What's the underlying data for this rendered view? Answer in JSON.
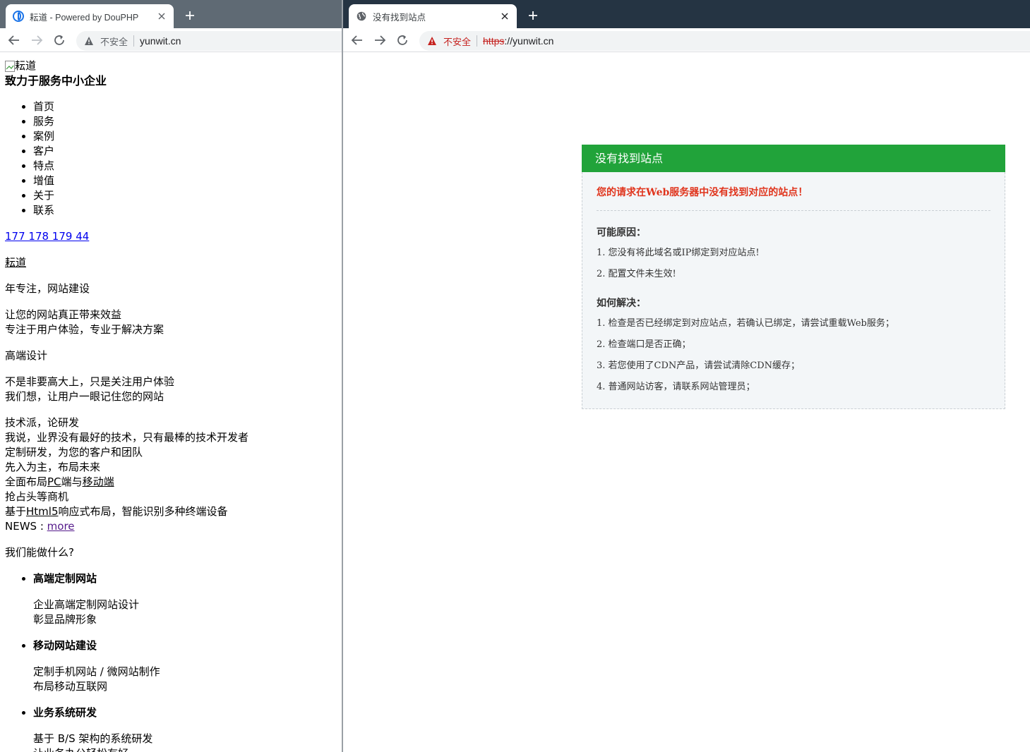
{
  "left_window": {
    "tab": {
      "title": "耘道 - Powered by DouPHP",
      "favicon": "douphp-logo-icon"
    },
    "address_bar": {
      "security_label": "不安全",
      "url": "yunwit.cn"
    },
    "page": {
      "logo_alt": "耘道",
      "tagline": "致力于服务中小企业",
      "nav_items": [
        "首页",
        "服务",
        "案例",
        "客户",
        "特点",
        "增值",
        "关于",
        "联系"
      ],
      "phone": "177 178 179 44",
      "brand_link": "耘道",
      "years_text": "年专注，网站建设",
      "value_line_1": "让您的网站真正带来效益",
      "value_line_2": "专注于用户体验，专业于解决方案",
      "design_heading": "高端设计",
      "design_line_1": "不是非要高大上，只是关注用户体验",
      "design_line_2": "我们想，让用户一眼记住您的网站",
      "tech_lines": {
        "l1": "技术派，论研发",
        "l2": "我说，业界没有最好的技术，只有最棒的技术开发者",
        "l3": "定制研发，为您的客户和团队",
        "l4": "先入为主，布局未来",
        "l5_a": "全面布局",
        "l5_b": "PC",
        "l5_c": "端与",
        "l5_d": "移动端",
        "l6": "抢占头等商机",
        "l7_a": "基于",
        "l7_b": "Html5",
        "l7_c": "响应式布局，智能识别多种终端设备"
      },
      "news_label": "NEWS :",
      "news_more": "more",
      "what_heading": "我们能做什么?",
      "services": [
        {
          "title": "高端定制网站",
          "line_1": "企业高端定制网站设计",
          "line_2": "彰显品牌形象"
        },
        {
          "title": "移动网站建设",
          "line_1": "定制手机网站 / 微网站制作",
          "line_2": "布局移动互联网"
        },
        {
          "title": "业务系统研发",
          "line_1": "基于 B/S 架构的系统研发",
          "line_2": "让业务办公轻松有好"
        }
      ]
    }
  },
  "right_window": {
    "tab": {
      "title": "没有找到站点",
      "favicon": "globe-icon"
    },
    "address_bar": {
      "security_label": "不安全",
      "url_scheme": "https",
      "url_rest": "://yunwit.cn"
    },
    "page": {
      "header": "没有找到站点",
      "message": "您的请求在Web服务器中没有找到对应的站点！",
      "reasons_title": "可能原因：",
      "reasons": [
        "1. 您没有将此域名或IP绑定到对应站点!",
        "2. 配置文件未生效!"
      ],
      "solutions_title": "如何解决：",
      "solutions": [
        "1. 检查是否已经绑定到对应站点，若确认已绑定，请尝试重载Web服务；",
        "2. 检查端口是否正确；",
        "3. 若您使用了CDN产品，请尝试清除CDN缓存；",
        "4. 普通网站访客，请联系网站管理员；"
      ]
    }
  },
  "colors": {
    "error_header": "#21a33a",
    "error_message": "#e0341c",
    "insecure_red": "#c5221f",
    "left_tabstrip": "#5f6a74",
    "right_tabstrip": "#253443"
  }
}
